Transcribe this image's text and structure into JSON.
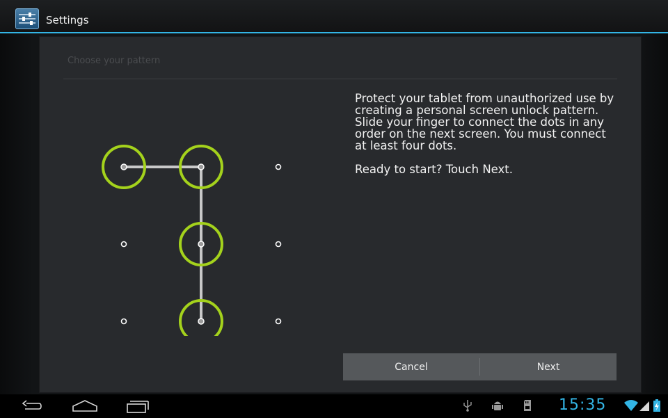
{
  "app": {
    "title": "Settings",
    "icon": "settings-sliders-icon",
    "accent_color": "#33b5e5"
  },
  "screen": {
    "title": "Choose your pattern",
    "description": [
      "Protect your tablet from unauthorized use by creating a personal screen unlock pattern. Slide your finger to connect the dots in any order on the next screen. You must connect at least four dots.",
      "Ready to start? Touch Next."
    ],
    "pattern": {
      "grid_size": 3,
      "sequence": [
        0,
        1,
        4,
        7
      ],
      "active_color": "#a4d21c"
    },
    "buttons": {
      "cancel": "Cancel",
      "next": "Next"
    }
  },
  "status_bar": {
    "time": "15:35",
    "icons": [
      "usb-icon",
      "android-debug-icon",
      "sd-card-icon",
      "wifi-icon",
      "cell-signal-icon",
      "battery-charging-icon"
    ]
  },
  "nav_bar": {
    "buttons": [
      "back-icon",
      "home-icon",
      "recent-apps-icon"
    ]
  }
}
